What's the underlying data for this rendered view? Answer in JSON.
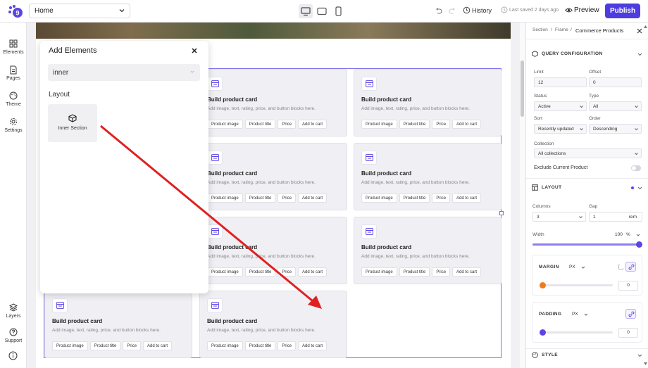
{
  "topbar": {
    "page_select": "Home",
    "history": "History",
    "last_saved": "Last saved 2 days ago",
    "preview": "Preview",
    "publish": "Publish"
  },
  "rail": {
    "elements": "Elements",
    "pages": "Pages",
    "theme": "Theme",
    "settings": "Settings",
    "layers": "Layers",
    "support": "Support"
  },
  "popup": {
    "title": "Add Elements",
    "search_value": "inner",
    "section": "Layout",
    "tile_label": "Inner Section"
  },
  "card_template": {
    "title": "Build product card",
    "desc": "Add image, text, rating, price, and button blocks here.",
    "chips": [
      "Product image",
      "Product title",
      "Price",
      "Add to cart"
    ]
  },
  "panel": {
    "crumb_1": "Section",
    "crumb_sep": "/",
    "crumb_2": "Frame",
    "crumb_3": "Commerce Products",
    "query_heading": "QUERY CONFIGURATION",
    "limit_label": "Limit",
    "limit_value": "12",
    "offset_label": "Offset",
    "offset_value": "0",
    "status_label": "Status",
    "status_value": "Active",
    "type_label": "Type",
    "type_value": "All",
    "sort_label": "Sort",
    "sort_value": "Recently updated",
    "order_label": "Order",
    "order_value": "Descending",
    "collection_label": "Collection",
    "collection_value": "All collections",
    "exclude_label": "Exclude Current Product",
    "exclude_on": false,
    "layout_heading": "LAYOUT",
    "columns_label": "Columns",
    "columns_value": "3",
    "gap_label": "Gap",
    "gap_value": "1",
    "gap_unit": "rem",
    "width_label": "Width",
    "width_value": "100",
    "width_unit": "%",
    "width_fraction": 1.0,
    "margin_label": "MARGIN",
    "margin_unit": "PX",
    "margin_value": "0",
    "padding_label": "PADDING",
    "padding_unit": "PX",
    "padding_value": "0",
    "style_heading": "STYLE"
  },
  "colors": {
    "accent": "#4d3de0",
    "frame": "#7b6fe8",
    "margin_knob": "#f07c1c",
    "padding_knob": "#5a45e6",
    "arrow": "#e02020"
  }
}
